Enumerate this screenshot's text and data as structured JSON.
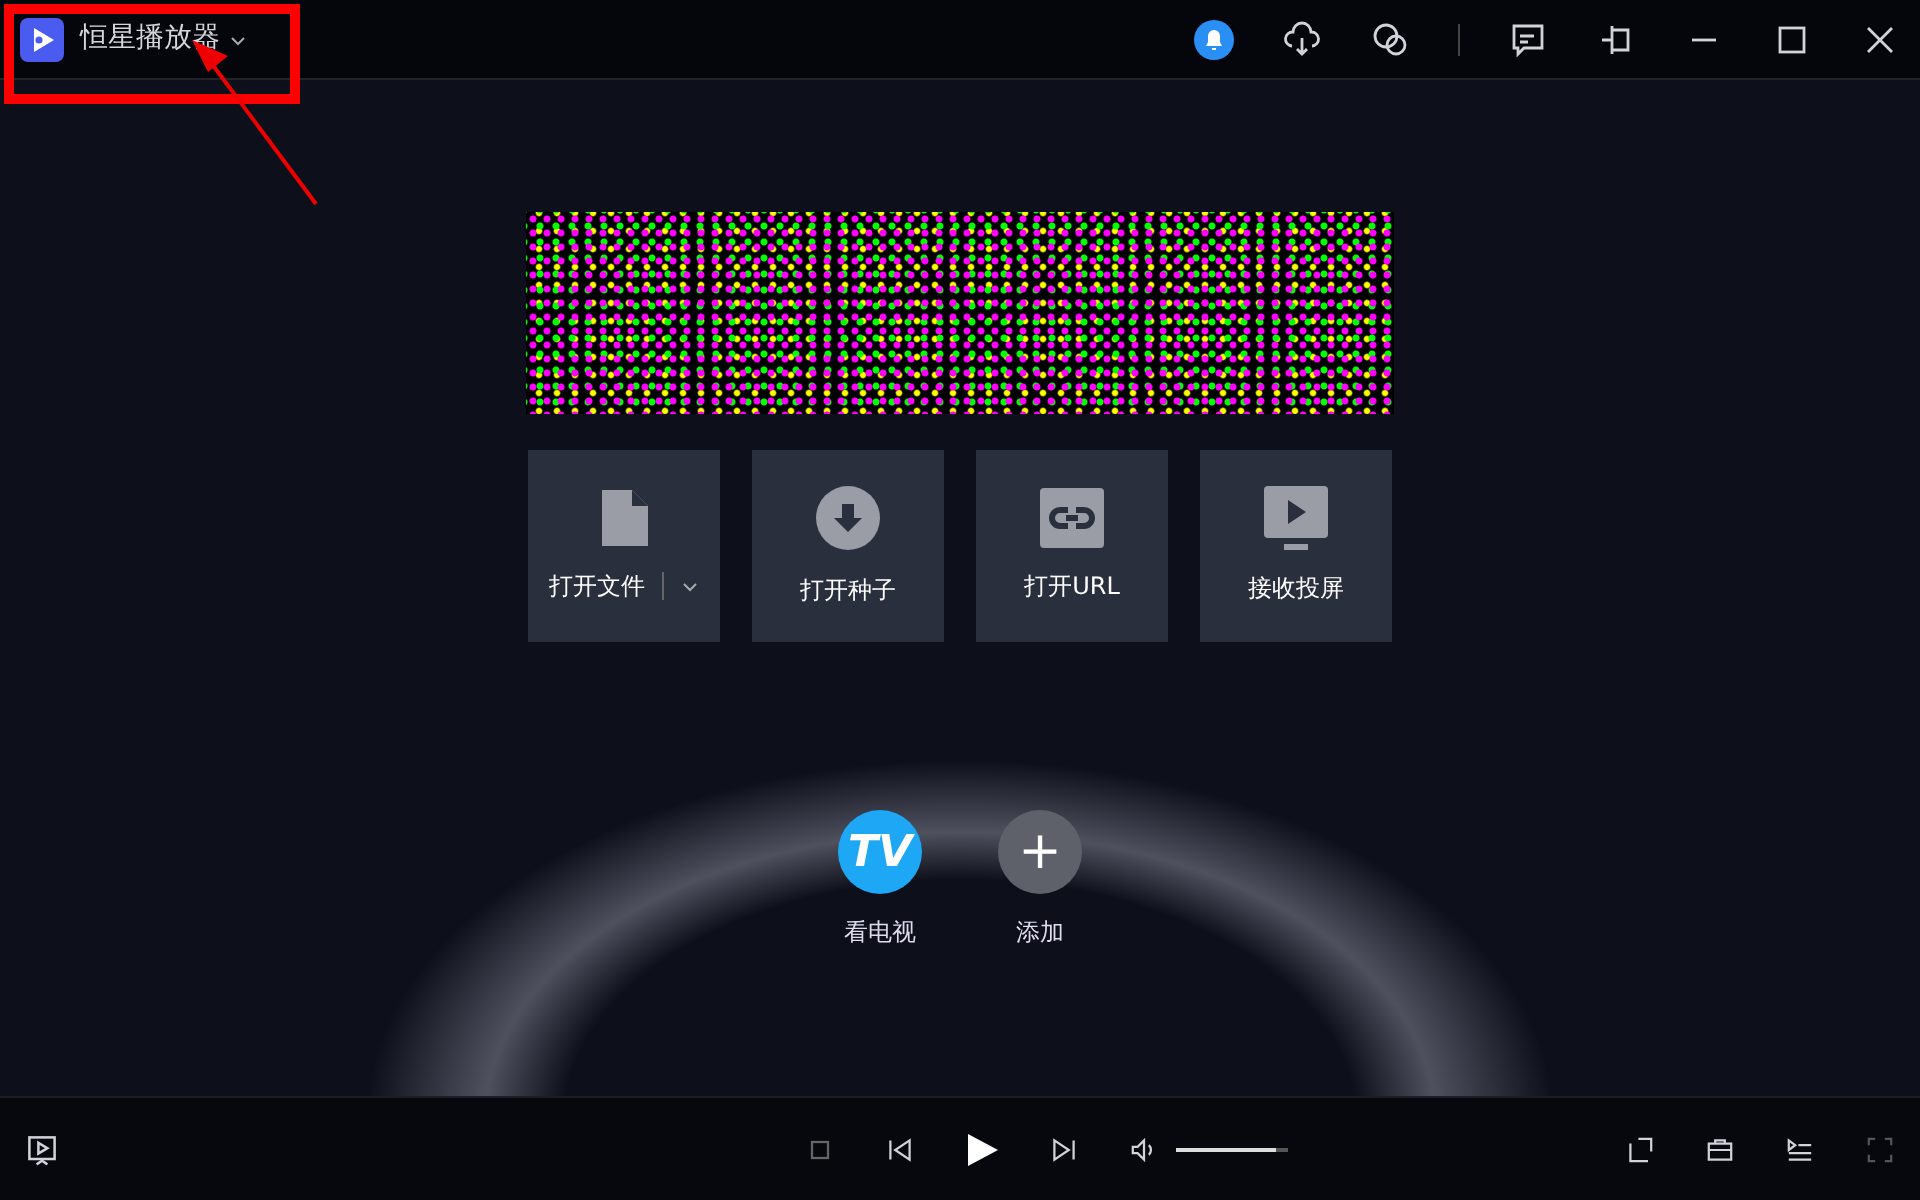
{
  "window": {
    "title": "恒星播放器"
  },
  "actions": [
    {
      "kind": "file",
      "label": "打开文件",
      "dropdown": true
    },
    {
      "kind": "torrent",
      "label": "打开种子",
      "dropdown": false
    },
    {
      "kind": "url",
      "label": "打开URL",
      "dropdown": false
    },
    {
      "kind": "cast",
      "label": "接收投屏",
      "dropdown": false
    }
  ],
  "shortcuts": [
    {
      "kind": "tv",
      "icon_text": "TV",
      "label": "看电视"
    },
    {
      "kind": "add",
      "icon_text": "+",
      "label": "添加"
    }
  ],
  "volume": {
    "level": 0.9
  }
}
